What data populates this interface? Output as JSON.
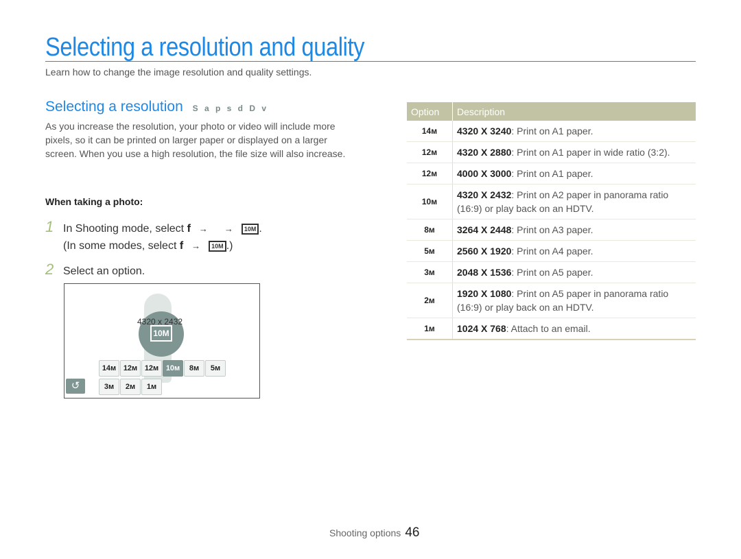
{
  "page": {
    "title": "Selecting a resolution and quality",
    "subtitle": "Learn how to change the image resolution and quality settings."
  },
  "section": {
    "heading": "Selecting a resolution",
    "mode_icons": "S a p s d D v",
    "paragraph": "As you increase the resolution, your photo or video will include more pixels, so it can be printed on larger paper or displayed on a larger screen. When you use a high resolution, the file size will also increase.",
    "subhead": "When taking a photo:",
    "steps": [
      {
        "num": "1",
        "line1_prefix": "In Shooting mode, select ",
        "key": "f",
        "arrow1": "→",
        "arrow2": "→",
        "icon": "10M",
        "line1_suffix": ".",
        "line2_prefix": "(In some modes, select ",
        "line2_key": "f",
        "line2_arrow": "→",
        "line2_icon": "10M",
        "line2_suffix": ".)"
      },
      {
        "num": "2",
        "text": "Select an option."
      }
    ]
  },
  "camera_screen": {
    "resolution_label": "4320 x 2432",
    "selected_icon": "10M",
    "row1": [
      "14M",
      "12M-wide",
      "12M",
      "10M",
      "8M",
      "5M"
    ],
    "row1_labels": [
      "14м",
      "12м",
      "12м",
      "10м",
      "8м",
      "5м"
    ],
    "row2_labels": [
      "3м",
      "2м",
      "1м"
    ],
    "back_icon": "↺"
  },
  "table": {
    "headers": [
      "Option",
      "Description"
    ],
    "rows": [
      {
        "icon": "14м",
        "res": "4320 X 3240",
        "desc": ": Print on A1 paper."
      },
      {
        "icon": "12м",
        "res": "4320 X 2880",
        "desc": ": Print on A1 paper in wide ratio (3:2)."
      },
      {
        "icon": "12м",
        "res": "4000 X 3000",
        "desc": ": Print on A1 paper."
      },
      {
        "icon": "10м",
        "res": "4320 X 2432",
        "desc": ": Print on A2 paper in panorama ratio (16:9) or play back on an HDTV."
      },
      {
        "icon": "8м",
        "res": "3264 X 2448",
        "desc": ": Print on A3 paper."
      },
      {
        "icon": "5м",
        "res": "2560 X 1920",
        "desc": ": Print on A4 paper."
      },
      {
        "icon": "3м",
        "res": "2048 X 1536",
        "desc": ": Print on A5 paper."
      },
      {
        "icon": "2м",
        "res": "1920 X 1080",
        "desc": ": Print on A5 paper in panorama ratio (16:9) or play back on an HDTV."
      },
      {
        "icon": "1м",
        "res": "1024 X 768",
        "desc": ": Attach to an email."
      }
    ]
  },
  "footer": {
    "section": "Shooting options",
    "page": "46"
  },
  "colors": {
    "accent": "#1e88e5",
    "table_header": "#c2c3a4",
    "step_number": "#a3c07a",
    "camera_ui": "#7f9592"
  }
}
